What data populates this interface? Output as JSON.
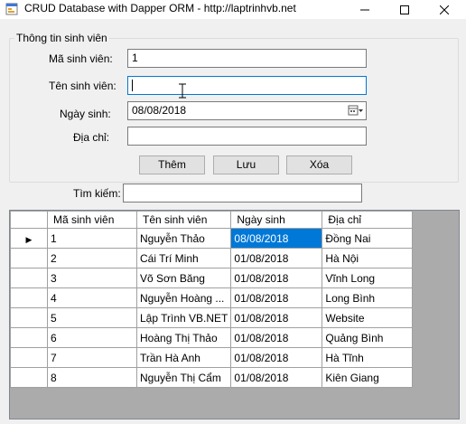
{
  "window": {
    "title": "CRUD Database with Dapper ORM - http://laptrinhvb.net",
    "icon": "app-form-icon"
  },
  "form": {
    "group_title": "Thông tin sinh viên",
    "student_id_label": "Mã sinh viên:",
    "student_id_value": "1",
    "name_label": "Tên sinh viên:",
    "name_value": "",
    "dob_label": "Ngày sinh:",
    "dob_value": "08/08/2018",
    "address_label": "Địa chỉ:",
    "address_value": ""
  },
  "buttons": {
    "add": "Thêm",
    "save": "Lưu",
    "delete": "Xóa"
  },
  "search": {
    "label": "Tìm kiếm:",
    "value": ""
  },
  "grid": {
    "columns": [
      "Mã  sinh viên",
      "Tên sinh viên",
      "Ngày sinh",
      "Địa chỉ"
    ],
    "current_row_marker": "▶",
    "selected_cell": {
      "row": 0,
      "column": 2
    },
    "rows": [
      [
        "1",
        "Nguyễn Thảo",
        "08/08/2018",
        "Đồng Nai"
      ],
      [
        "2",
        "Cái Trí Minh",
        "01/08/2018",
        "Hà Nội"
      ],
      [
        "3",
        "Võ Sơn Băng",
        "01/08/2018",
        "Vĩnh Long"
      ],
      [
        "4",
        "Nguyễn Hoàng ...",
        "01/08/2018",
        "Long Bình"
      ],
      [
        "5",
        "Lập Trình VB.NET",
        "01/08/2018",
        "Website"
      ],
      [
        "6",
        "Hoàng Thị Thảo",
        "01/08/2018",
        "Quảng Bình"
      ],
      [
        "7",
        "Trần Hà Anh",
        "01/08/2018",
        "Hà Tĩnh"
      ],
      [
        "8",
        "Nguyễn Thị Cẩm",
        "01/08/2018",
        "Kiên Giang"
      ]
    ]
  },
  "colors": {
    "selection": "#0078d7",
    "focus_border": "#0078d7",
    "grid_background": "#ababab"
  }
}
